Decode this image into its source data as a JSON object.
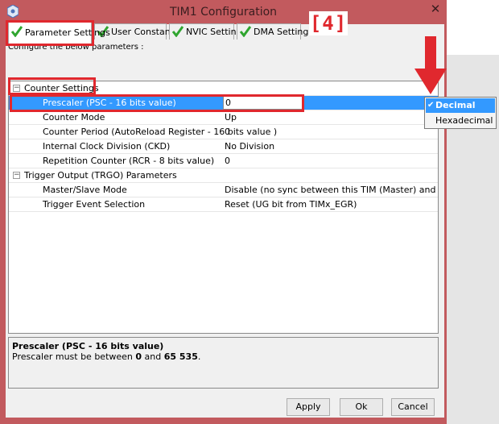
{
  "window": {
    "title": "TIM1 Configuration",
    "close_glyph": "✕"
  },
  "tabs": [
    {
      "label": "Parameter Settings",
      "icon": "check-icon"
    },
    {
      "label": "User Constants",
      "icon": "check-icon"
    },
    {
      "label": "NVIC Settings",
      "icon": "check-icon"
    },
    {
      "label": "DMA Settings",
      "icon": "check-icon"
    }
  ],
  "annotation": {
    "badge": "[4]"
  },
  "description": "Configure the below parameters :",
  "groups": [
    {
      "label": "Counter Settings",
      "expander": "−",
      "rows": [
        {
          "name": "Prescaler (PSC - 16 bits value)",
          "value": "0"
        },
        {
          "name": "Counter Mode",
          "value": "Up"
        },
        {
          "name": "Counter Period (AutoReload Register - 16 bits value )",
          "value": "0"
        },
        {
          "name": "Internal Clock Division (CKD)",
          "value": "No Division"
        },
        {
          "name": "Repetition Counter (RCR - 8 bits value)",
          "value": "0"
        }
      ]
    },
    {
      "label": "Trigger Output (TRGO) Parameters",
      "expander": "−",
      "rows": [
        {
          "name": "Master/Slave Mode",
          "value": "Disable (no sync between this TIM (Master) and its Slaves"
        },
        {
          "name": "Trigger Event Selection",
          "value": "Reset (UG bit from TIMx_EGR)"
        }
      ]
    }
  ],
  "info": {
    "title": "Prescaler (PSC - 16 bits value)",
    "text_prefix": "Prescaler must be between ",
    "min": "0",
    "mid": " and ",
    "max": "65 535",
    "suffix": "."
  },
  "buttons": {
    "apply": "Apply",
    "ok": "Ok",
    "cancel": "Cancel"
  },
  "dropdown": {
    "options": [
      {
        "label": "Decimal",
        "selected": true,
        "check": "✔"
      },
      {
        "label": "Hexadecimal",
        "selected": false
      }
    ]
  },
  "colors": {
    "highlight": "#e0282e",
    "selection": "#3399ff",
    "window_frame": "#c25a5e"
  }
}
